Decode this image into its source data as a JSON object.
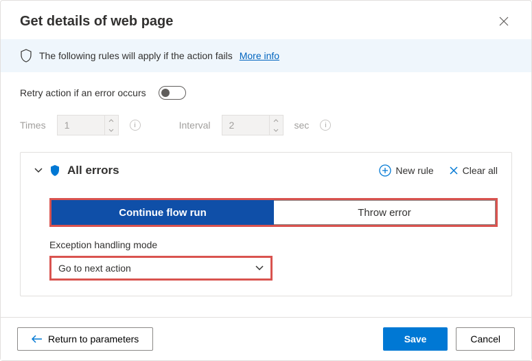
{
  "header": {
    "title": "Get details of web page"
  },
  "info": {
    "text": "The following rules will apply if the action fails",
    "more_info": "More info"
  },
  "retry": {
    "label": "Retry action if an error occurs",
    "times_label": "Times",
    "times_value": "1",
    "interval_label": "Interval",
    "interval_value": "2",
    "interval_unit": "sec"
  },
  "errors": {
    "title": "All errors",
    "new_rule": "New rule",
    "clear_all": "Clear all",
    "continue_label": "Continue flow run",
    "throw_label": "Throw error",
    "eh_mode_label": "Exception handling mode",
    "eh_mode_value": "Go to next action"
  },
  "footer": {
    "return": "Return to parameters",
    "save": "Save",
    "cancel": "Cancel"
  },
  "colors": {
    "accent": "#0078d4",
    "highlight": "#d9534f",
    "segment_active": "#0f4fa8"
  }
}
